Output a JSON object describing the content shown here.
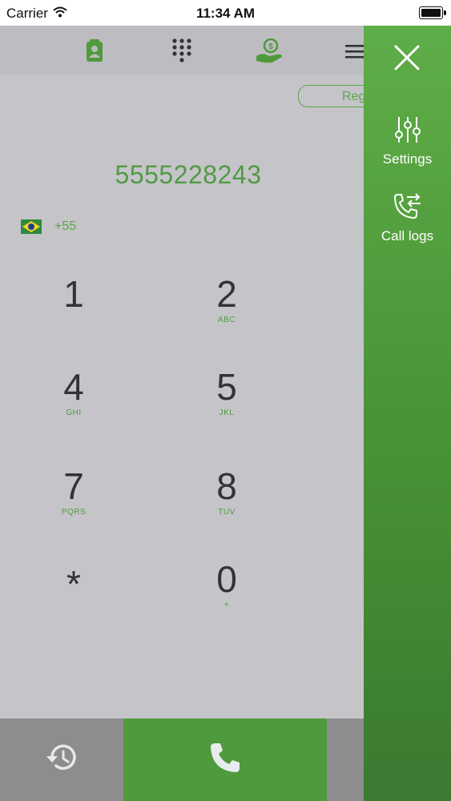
{
  "status_bar": {
    "carrier": "Carrier",
    "time": "11:34 AM"
  },
  "toolbar": {
    "icons": [
      "contacts-icon",
      "keypad-icon",
      "credit-icon",
      "menu-icon"
    ]
  },
  "register_button": {
    "label": "Reg"
  },
  "dialer": {
    "number": "5555228243",
    "country_code": "+55",
    "keys": [
      {
        "digit": "1",
        "letters": ""
      },
      {
        "digit": "2",
        "letters": "ABC"
      },
      {
        "digit": "4",
        "letters": "GHI"
      },
      {
        "digit": "5",
        "letters": "JKL"
      },
      {
        "digit": "7",
        "letters": "PQRS"
      },
      {
        "digit": "8",
        "letters": "TUV"
      },
      {
        "digit": "*",
        "letters": ""
      },
      {
        "digit": "0",
        "letters": "+"
      }
    ]
  },
  "drawer": {
    "items": [
      {
        "label": "Settings",
        "icon": "sliders-icon"
      },
      {
        "label": "Call logs",
        "icon": "call-log-icon"
      }
    ]
  },
  "colors": {
    "accent_green": "#4f9a3c",
    "background": "#c5c4c9"
  }
}
